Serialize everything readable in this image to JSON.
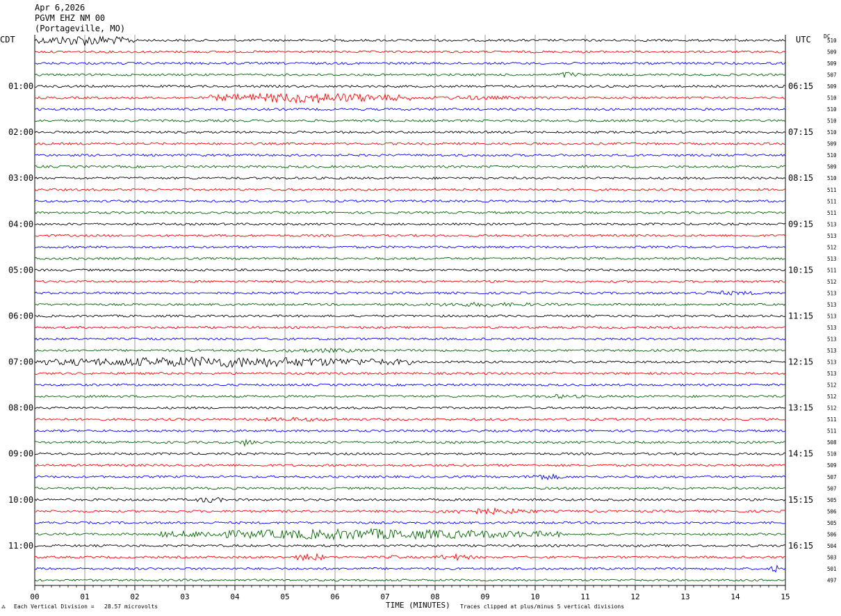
{
  "header": {
    "date": "Apr 6,2026",
    "station": "PGVM EHZ NM 00",
    "location": "(Portageville, MO)"
  },
  "left_axis_label": "CDT",
  "right_axis_label": "UTC",
  "dc_label": "DC",
  "footer": {
    "icon": "logo-icon",
    "scale_note": "Each Vertical Division =   28.57 microvolts",
    "xaxis_title": "TIME (MINUTES)",
    "clip_note": "Traces clipped at plus/minus 5 vertical divisions"
  },
  "colors": {
    "trace_cycle": [
      "#000000",
      "#ff0000",
      "#0000ff",
      "#006400"
    ],
    "grid": "#808080"
  },
  "chart_data": {
    "type": "line",
    "title": "",
    "xlabel": "TIME (MINUTES)",
    "ylabel": "",
    "x_ticks": [
      "00",
      "01",
      "02",
      "03",
      "04",
      "05",
      "06",
      "07",
      "08",
      "09",
      "10",
      "11",
      "12",
      "13",
      "14",
      "15"
    ],
    "xlim": [
      0,
      15
    ],
    "left_time_labels": [
      {
        "row": 4,
        "label": "01:00"
      },
      {
        "row": 8,
        "label": "02:00"
      },
      {
        "row": 12,
        "label": "03:00"
      },
      {
        "row": 16,
        "label": "04:00"
      },
      {
        "row": 20,
        "label": "05:00"
      },
      {
        "row": 24,
        "label": "06:00"
      },
      {
        "row": 28,
        "label": "07:00"
      },
      {
        "row": 32,
        "label": "08:00"
      },
      {
        "row": 36,
        "label": "09:00"
      },
      {
        "row": 40,
        "label": "10:00"
      },
      {
        "row": 44,
        "label": "11:00"
      }
    ],
    "right_time_labels": [
      {
        "row": 4,
        "label": "06:15"
      },
      {
        "row": 8,
        "label": "07:15"
      },
      {
        "row": 12,
        "label": "08:15"
      },
      {
        "row": 16,
        "label": "09:15"
      },
      {
        "row": 20,
        "label": "10:15"
      },
      {
        "row": 24,
        "label": "11:15"
      },
      {
        "row": 28,
        "label": "12:15"
      },
      {
        "row": 32,
        "label": "13:15"
      },
      {
        "row": 36,
        "label": "14:15"
      },
      {
        "row": 40,
        "label": "15:15"
      },
      {
        "row": 44,
        "label": "16:15"
      }
    ],
    "dc_values": [
      "510",
      "509",
      "509",
      "507",
      "509",
      "510",
      "510",
      "510",
      "510",
      "509",
      "510",
      "509",
      "510",
      "511",
      "511",
      "511",
      "513",
      "513",
      "512",
      "513",
      "511",
      "512",
      "513",
      "513",
      "513",
      "513",
      "513",
      "513",
      "513",
      "513",
      "512",
      "512",
      "512",
      "511",
      "511",
      "508",
      "510",
      "509",
      "507",
      "507",
      "505",
      "506",
      "505",
      "506",
      "504",
      "503",
      "501",
      "497"
    ],
    "rows": 48,
    "events": [
      {
        "row": 0,
        "start": 0.0,
        "end": 2.0,
        "amplitude": 5
      },
      {
        "row": 3,
        "start": 10.4,
        "end": 10.9,
        "amplitude": 3
      },
      {
        "row": 5,
        "start": 3.5,
        "end": 7.5,
        "amplitude": 5
      },
      {
        "row": 5,
        "start": 7.5,
        "end": 10.0,
        "amplitude": 2
      },
      {
        "row": 22,
        "start": 12.7,
        "end": 14.9,
        "amplitude": 2
      },
      {
        "row": 23,
        "start": 7.0,
        "end": 10.8,
        "amplitude": 2
      },
      {
        "row": 27,
        "start": 4.5,
        "end": 7.0,
        "amplitude": 2
      },
      {
        "row": 28,
        "start": 0.0,
        "end": 7.5,
        "amplitude": 5
      },
      {
        "row": 31,
        "start": 10.0,
        "end": 11.0,
        "amplitude": 2
      },
      {
        "row": 33,
        "start": 4.0,
        "end": 6.5,
        "amplitude": 2
      },
      {
        "row": 35,
        "start": 4.1,
        "end": 4.4,
        "amplitude": 4
      },
      {
        "row": 38,
        "start": 9.8,
        "end": 10.6,
        "amplitude": 3
      },
      {
        "row": 40,
        "start": 3.2,
        "end": 3.8,
        "amplitude": 3
      },
      {
        "row": 41,
        "start": 8.0,
        "end": 10.1,
        "amplitude": 3
      },
      {
        "row": 43,
        "start": 2.5,
        "end": 10.5,
        "amplitude": 5
      },
      {
        "row": 45,
        "start": 5.2,
        "end": 5.8,
        "amplitude": 4
      },
      {
        "row": 45,
        "start": 7.0,
        "end": 7.4,
        "amplitude": 2
      },
      {
        "row": 45,
        "start": 8.0,
        "end": 8.8,
        "amplitude": 3
      },
      {
        "row": 46,
        "start": 14.7,
        "end": 14.9,
        "amplitude": 4
      }
    ]
  }
}
